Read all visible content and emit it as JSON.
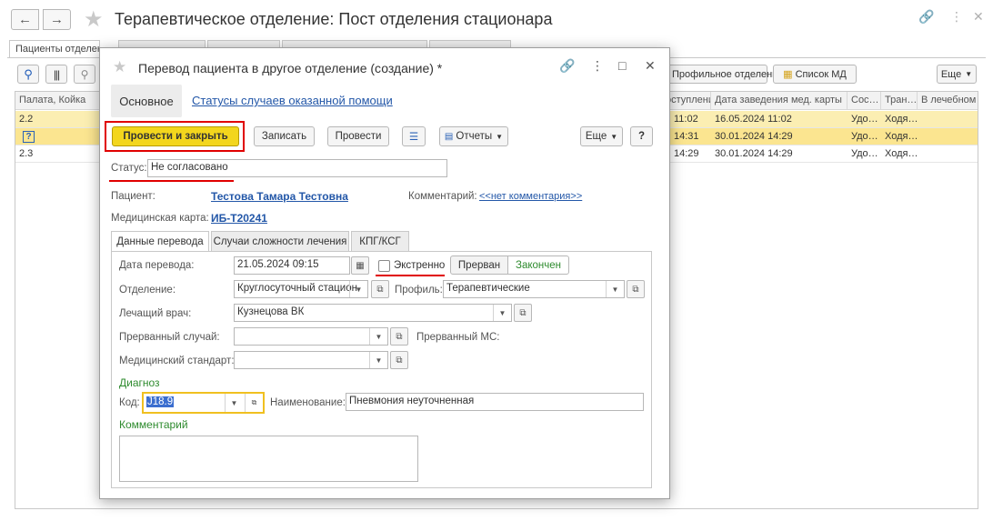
{
  "main": {
    "title": "Терапевтическое отделение: Пост отделения стационара",
    "tabs": [
      "Пациенты отделения",
      "",
      "",
      "",
      ""
    ],
    "toolbar": {
      "transfer_to": "Профильное отделение",
      "md_list": "Список МД",
      "more": "Еще"
    },
    "grid": {
      "columns": [
        "Палата, Койка",
        "…оступления",
        "Дата заведения мед. карты",
        "Сос…",
        "Тран…",
        "В лечебном"
      ],
      "rows": [
        {
          "ward": "2.2",
          "admitted": "11:02",
          "card_date": "16.05.2024 11:02",
          "state": "Удо…",
          "transport": "Ходя…"
        },
        {
          "ward": "?",
          "admitted": "14:31",
          "card_date": "30.01.2024 14:29",
          "state": "Удо…",
          "transport": "Ходя…"
        },
        {
          "ward": "2.3",
          "admitted": "14:29",
          "card_date": "30.01.2024 14:29",
          "state": "Удо…",
          "transport": "Ходя…"
        }
      ]
    }
  },
  "dialog": {
    "title": "Перевод пациента в другое отделение (создание) *",
    "nav": {
      "main": "Основное",
      "statuses_link": "Статусы случаев оказанной помощи"
    },
    "toolbar": {
      "post_close": "Провести и закрыть",
      "save": "Записать",
      "post": "Провести",
      "reports": "Отчеты",
      "more": "Еще",
      "help": "?"
    },
    "status": {
      "label": "Статус:",
      "value": "Не согласовано"
    },
    "patient": {
      "label": "Пациент:",
      "value": "Тестова Тамара Тестовна"
    },
    "comment_link": {
      "label": "Комментарий:",
      "value": "<<нет комментария>>"
    },
    "card": {
      "label": "Медицинская карта:",
      "value": "ИБ-Т20241"
    },
    "tabs": [
      "Данные перевода",
      "Случаи сложности лечения",
      "КПГ/КСГ"
    ],
    "form": {
      "date_label": "Дата перевода:",
      "date_value": "21.05.2024 09:15",
      "urgent_label": "Экстренно",
      "interrupted": "Прерван",
      "finished": "Закончен",
      "department_label": "Отделение:",
      "department_value": "Круглосуточный стацион",
      "profile_label": "Профиль:",
      "profile_value": "Терапевтические",
      "doctor_label": "Лечащий врач:",
      "doctor_value": "Кузнецова ВК",
      "interrupted_case_label": "Прерванный случай:",
      "interrupted_ms_label": "Прерванный МС:",
      "standard_label": "Медицинский стандарт:",
      "diagnosis_title": "Диагноз",
      "code_label": "Код:",
      "code_value": "J18.9",
      "name_label": "Наименование:",
      "name_value": "Пневмония неуточненная",
      "comment_title": "Комментарий"
    }
  }
}
